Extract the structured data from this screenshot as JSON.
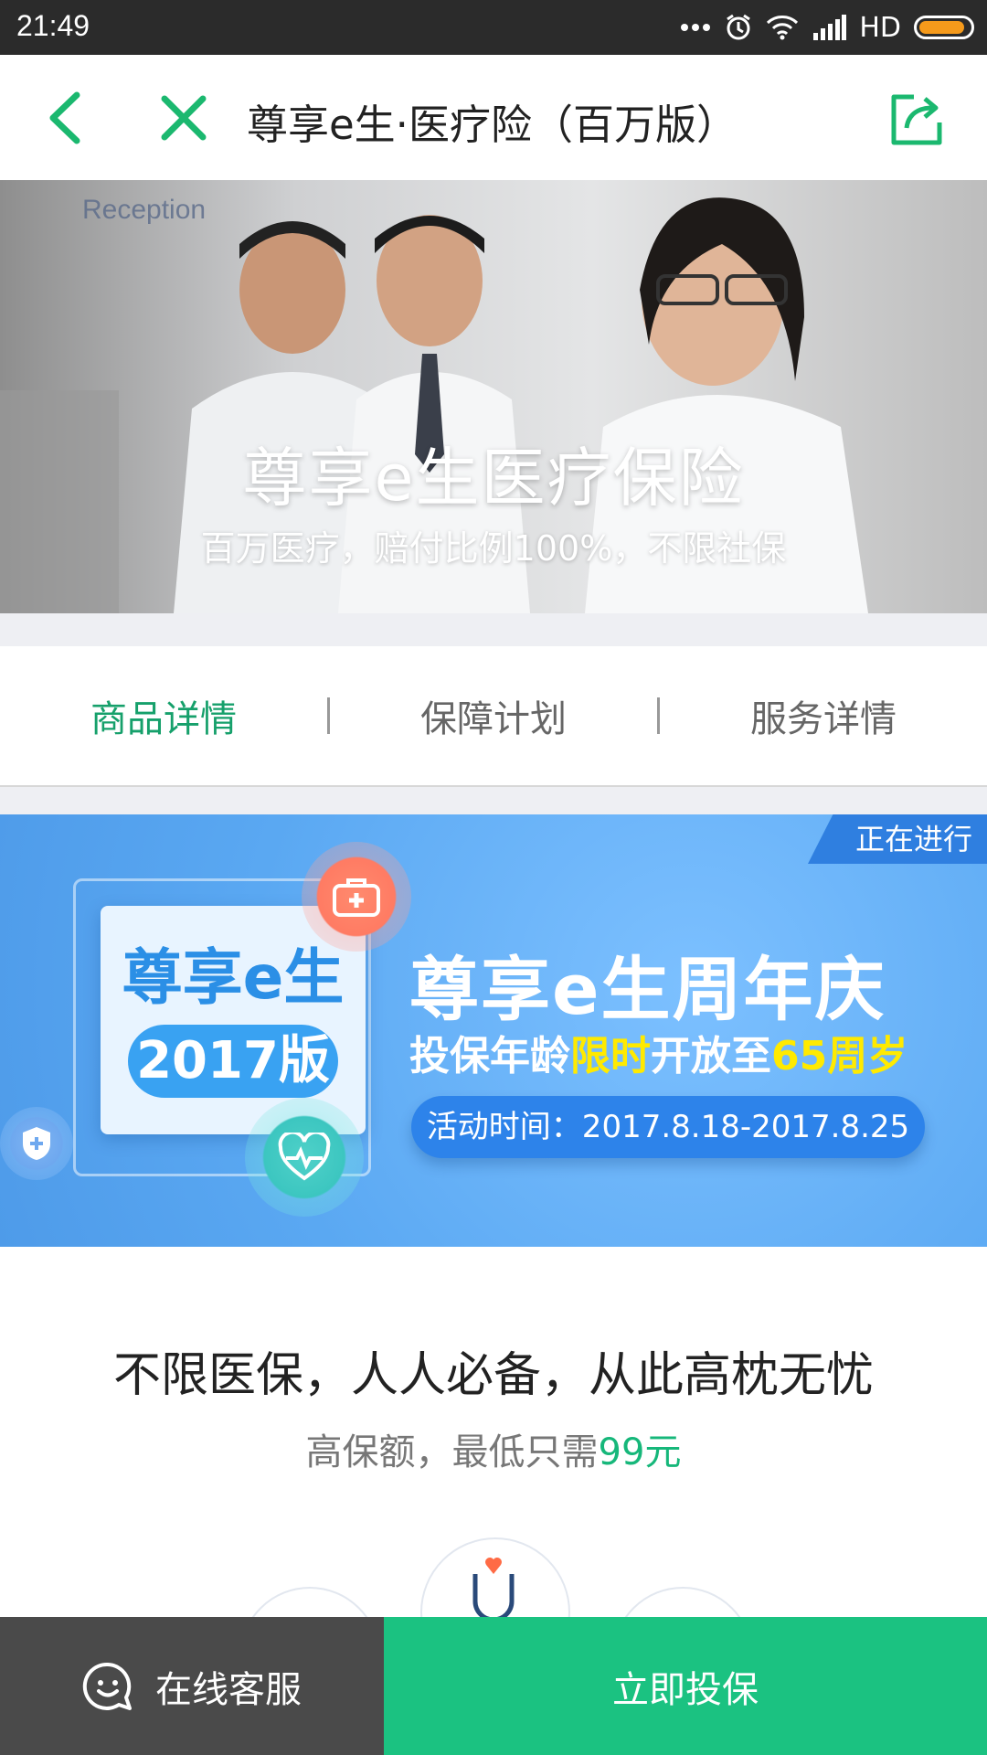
{
  "status_bar": {
    "time": "21:49",
    "network": "HD",
    "battery_level": 0.9,
    "battery_color": "#f59a1b"
  },
  "nav": {
    "title": "尊享e生·医疗险（百万版）",
    "accent": "#1bb86f"
  },
  "hero": {
    "sign": "Reception",
    "title": "尊享e生医疗保险",
    "subtitle": "百万医疗，赔付比例100%，不限社保"
  },
  "tabs": [
    {
      "label": "商品详情",
      "active": true
    },
    {
      "label": "保障计划",
      "active": false
    },
    {
      "label": "服务详情",
      "active": false
    }
  ],
  "banner": {
    "badge": "正在进行",
    "logo_text": "尊享e生",
    "logo_year": "2017版",
    "headline": "尊享e生周年庆",
    "line2_part1": "投保年龄",
    "line2_highlight1": "限时",
    "line2_part2": "开放至",
    "line2_highlight2": "65周岁",
    "period": "活动时间：2017.8.18-2017.8.25"
  },
  "section": {
    "heading": "不限医保，人人必备，从此高枕无忧",
    "sub_prefix": "高保额，最低只需",
    "sub_price": "99元"
  },
  "bottom_bar": {
    "service_label": "在线客服",
    "buy_label": "立即投保",
    "buy_color": "#1bc281",
    "service_color": "#4a4a4a"
  }
}
